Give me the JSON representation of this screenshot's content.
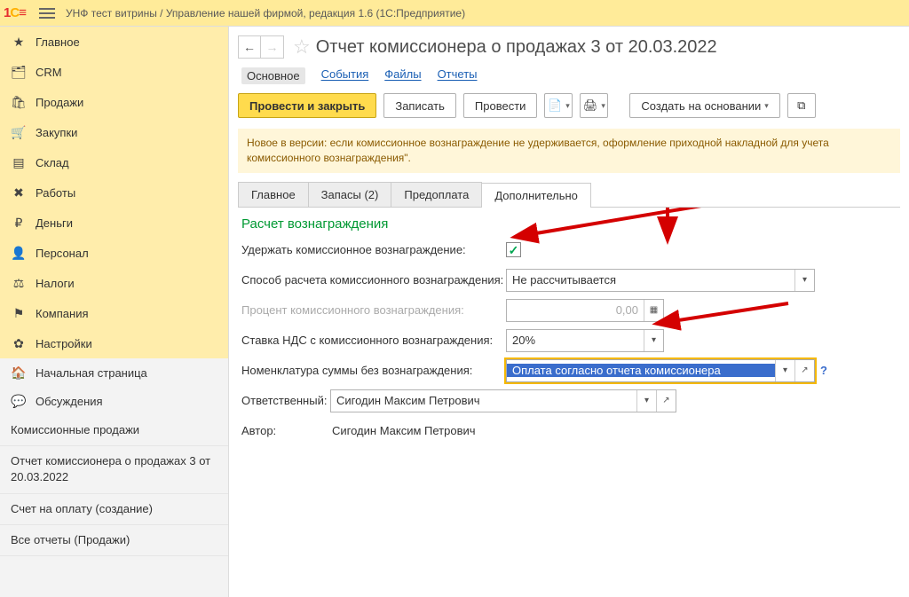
{
  "topbar": {
    "title": "УНФ тест витрины / Управление нашей фирмой, редакция 1.6  (1С:Предприятие)"
  },
  "sidebar": {
    "upper": [
      {
        "icon": "★",
        "label": "Главное"
      },
      {
        "icon": "🗂",
        "label": "CRM"
      },
      {
        "icon": "🛒",
        "label": "Продажи"
      },
      {
        "icon": "📦",
        "label": "Закупки"
      },
      {
        "icon": "🏭",
        "label": "Склад"
      },
      {
        "icon": "🛠",
        "label": "Работы"
      },
      {
        "icon": "₽",
        "label": "Деньги"
      },
      {
        "icon": "👤",
        "label": "Персонал"
      },
      {
        "icon": "🏛",
        "label": "Налоги"
      },
      {
        "icon": "🏢",
        "label": "Компания"
      },
      {
        "icon": "⚙",
        "label": "Настройки"
      }
    ],
    "lower_nav": [
      {
        "icon": "🏠",
        "label": "Начальная страница"
      },
      {
        "icon": "💬",
        "label": "Обсуждения"
      }
    ],
    "plain": [
      "Комиссионные продажи",
      "Отчет комиссионера о продажах 3 от 20.03.2022",
      "Счет на оплату (создание)",
      "Все отчеты (Продажи)"
    ]
  },
  "header": {
    "title": "Отчет комиссионера о продажах 3 от 20.03.2022"
  },
  "subtabs": {
    "main": "Основное",
    "events": "События",
    "files": "Файлы",
    "reports": "Отчеты"
  },
  "toolbar": {
    "post_close": "Провести и закрыть",
    "save": "Записать",
    "post": "Провести",
    "create_based": "Создать на основании"
  },
  "info_strip": "Новое в версии: если комиссионное вознаграждение не удерживается, оформление приходной накладной для учета комиссионного вознаграждения\".",
  "tabs": {
    "t1": "Главное",
    "t2": "Запасы (2)",
    "t3": "Предоплата",
    "t4": "Дополнительно"
  },
  "form": {
    "section": "Расчет вознаграждения",
    "hold_label": "Удержать комиссионное вознаграждение:",
    "method_label": "Способ расчета комиссионного вознаграждения:",
    "method_value": "Не рассчитывается",
    "percent_label": "Процент комиссионного вознаграждения:",
    "percent_value": "0,00",
    "vat_label": "Ставка НДС с комиссионного вознаграждения:",
    "vat_value": "20%",
    "nomen_label": "Номенклатура суммы без вознаграждения:",
    "nomen_value": "Оплата согласно отчета комиссионера",
    "resp_label": "Ответственный:",
    "resp_value": "Сигодин Максим Петрович",
    "author_label": "Автор:",
    "author_value": "Сигодин Максим Петрович"
  }
}
